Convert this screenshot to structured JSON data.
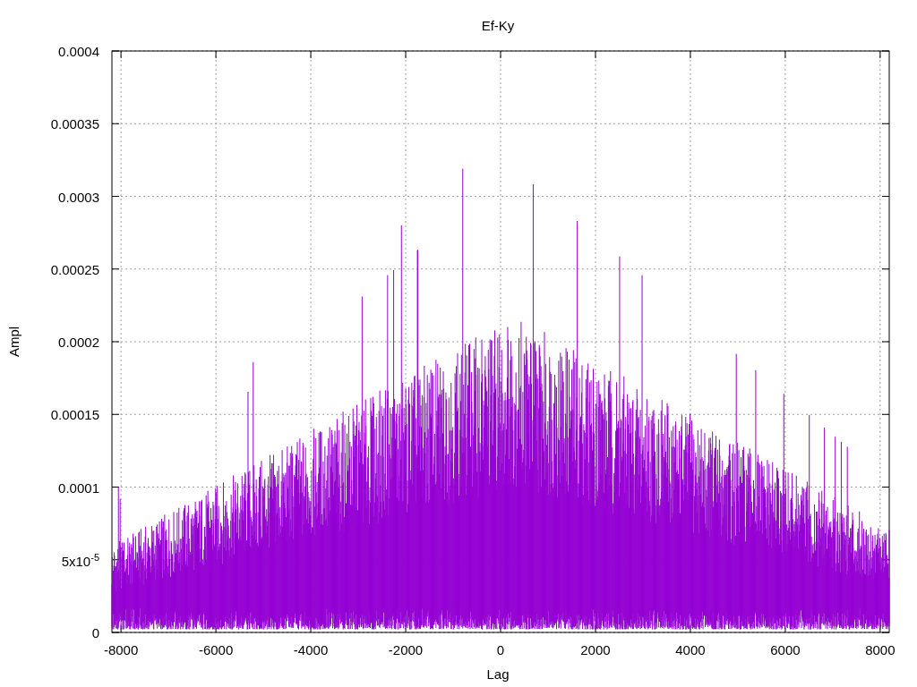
{
  "chart_data": {
    "type": "line",
    "title": "Ef-Ky",
    "xlabel": "Lag",
    "ylabel": "Ampl",
    "grid": true,
    "xlim": [
      -8191,
      8191
    ],
    "ylim": [
      0,
      0.0004
    ],
    "xticks": [
      -8000,
      -6000,
      -4000,
      -2000,
      0,
      2000,
      4000,
      6000,
      8000
    ],
    "yticks": [
      {
        "value": 0,
        "label": "0"
      },
      {
        "value": 5e-05,
        "label": "5x10$^{-5}$"
      },
      {
        "value": 0.0001,
        "label": "0.0001"
      },
      {
        "value": 0.00015,
        "label": "0.00015"
      },
      {
        "value": 0.0002,
        "label": "0.0002"
      },
      {
        "value": 0.00025,
        "label": "0.00025"
      },
      {
        "value": 0.0003,
        "label": "0.0003"
      },
      {
        "value": 0.00035,
        "label": "0.00035"
      },
      {
        "value": 0.0004,
        "label": "0.0004"
      }
    ]
  }
}
